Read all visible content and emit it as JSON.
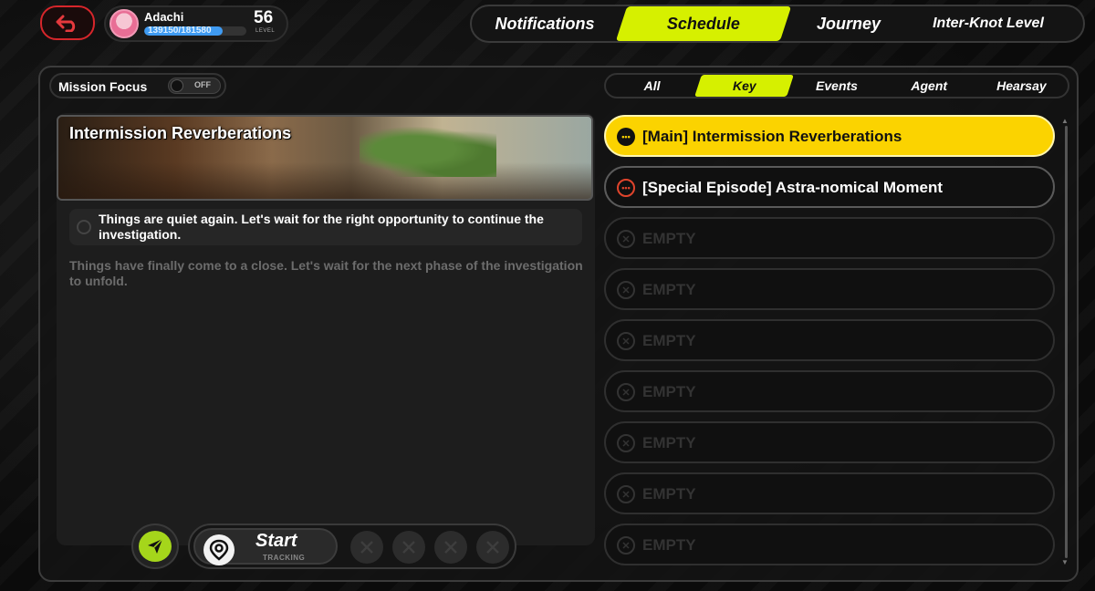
{
  "header": {
    "player_name": "Adachi",
    "xp_text": "139150/181580",
    "xp_progress": 0.766,
    "level_number": "56",
    "level_label": "LEVEL"
  },
  "top_tabs": [
    {
      "label": "Notifications",
      "active": false
    },
    {
      "label": "Schedule",
      "active": true
    },
    {
      "label": "Journey",
      "active": false
    },
    {
      "label": "Inter-Knot Level",
      "active": false
    }
  ],
  "mission_focus": {
    "label": "Mission Focus",
    "toggle_text": "OFF"
  },
  "filter_tabs": [
    {
      "label": "All",
      "active": false
    },
    {
      "label": "Key",
      "active": true
    },
    {
      "label": "Events",
      "active": false
    },
    {
      "label": "Agent",
      "active": false
    },
    {
      "label": "Hearsay",
      "active": false
    }
  ],
  "detail": {
    "title": "Intermission Reverberations",
    "step": "Things are quiet again. Let's wait for the right opportunity to continue the investigation.",
    "sub_text": "Things have finally come to a close. Let's wait for the next phase of the investigation to unfold."
  },
  "tracking": {
    "start_label": "Start",
    "sub_label": "TRACKING"
  },
  "missions": [
    {
      "label": "[Main] Intermission Reverberations",
      "state": "active"
    },
    {
      "label": "[Special Episode] Astra-nomical Moment",
      "state": "filled"
    },
    {
      "label": "EMPTY",
      "state": "empty"
    },
    {
      "label": "EMPTY",
      "state": "empty"
    },
    {
      "label": "EMPTY",
      "state": "empty"
    },
    {
      "label": "EMPTY",
      "state": "empty"
    },
    {
      "label": "EMPTY",
      "state": "empty"
    },
    {
      "label": "EMPTY",
      "state": "empty"
    },
    {
      "label": "EMPTY",
      "state": "empty"
    }
  ],
  "colors": {
    "accent": "#d6f000",
    "active_row": "#fbd300",
    "back": "#d7262b",
    "xp": "#3f9bf2"
  }
}
